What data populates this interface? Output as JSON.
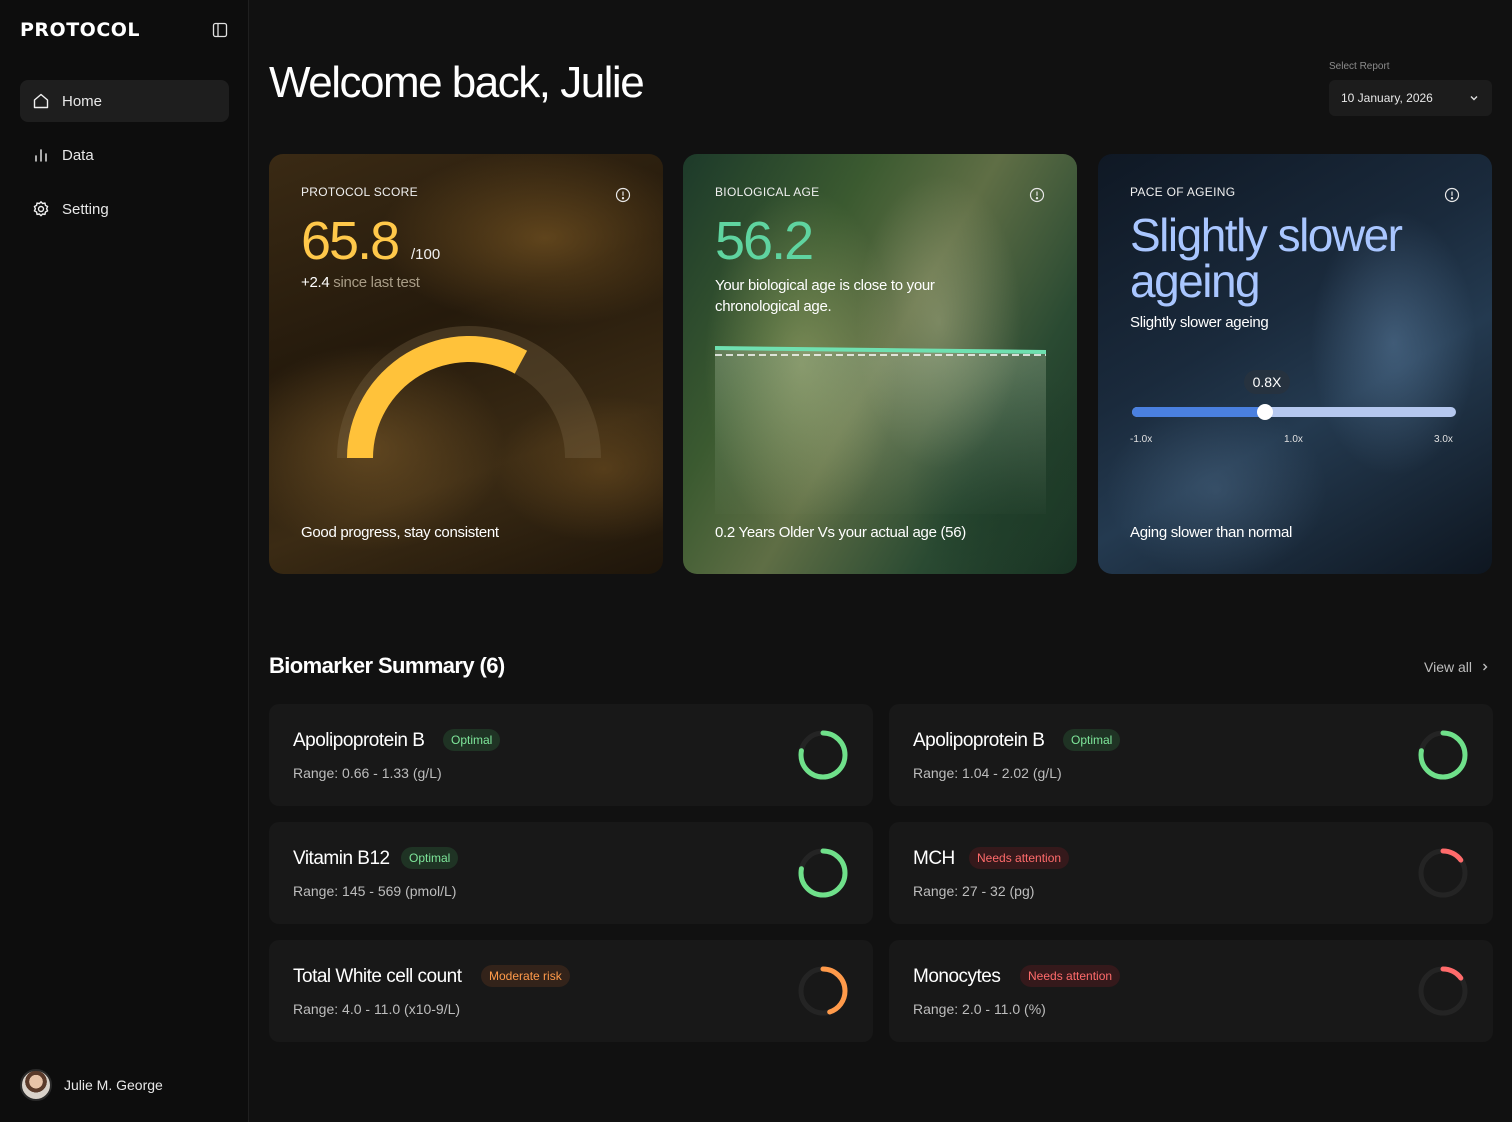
{
  "app": {
    "logo": "PROTOCOL"
  },
  "sidebar": {
    "items": [
      {
        "label": "Home",
        "icon": "home-icon",
        "active": true
      },
      {
        "label": "Data",
        "icon": "bar-chart-icon",
        "active": false
      },
      {
        "label": "Setting",
        "icon": "gear-icon",
        "active": false
      }
    ],
    "user": {
      "name": "Julie M. George"
    }
  },
  "header": {
    "title": "Welcome back, Julie",
    "report_label": "Select Report",
    "report_value": "10 January, 2026"
  },
  "cards": {
    "score": {
      "label": "PROTOCOL SCORE",
      "value": "65.8",
      "max": "/100",
      "delta": "+2.4",
      "delta_suffix": " since last test",
      "footer": "Good progress, stay consistent",
      "gauge_fraction": 0.658,
      "color": "#ffc84a"
    },
    "bio": {
      "label": "BIOLOGICAL AGE",
      "value": "56.2",
      "description": "Your biological age is close to your chronological age.",
      "footer": "0.2 Years Older Vs your actual age (56)",
      "color": "#5fd4a0"
    },
    "pace": {
      "label": "PACE OF AGEING",
      "value": "Slightly slower ageing",
      "subtitle": "Slightly slower ageing",
      "badge": "0.8X",
      "slider_fraction": 0.41,
      "ticks": [
        "-1.0x",
        "1.0x",
        "3.0x"
      ],
      "footer": "Aging slower than normal",
      "color": "#a9c6ff"
    }
  },
  "biomarkers": {
    "title": "Biomarker Summary (6)",
    "view_all": "View all",
    "items": [
      {
        "name": "Apolipoprotein B",
        "status": "Optimal",
        "range": "Range: 0.66 - 1.33 (g/L)",
        "level": 0.78,
        "color": "#6fe08a",
        "badge_bg": "#1f3324",
        "badge_fg": "#7ee69a"
      },
      {
        "name": "Apolipoprotein B",
        "status": "Optimal",
        "range": "Range: 1.04 - 2.02 (g/L)",
        "level": 0.78,
        "color": "#6fe08a",
        "badge_bg": "#1f3324",
        "badge_fg": "#7ee69a"
      },
      {
        "name": "Vitamin B12",
        "status": "Optimal",
        "range": "Range: 145 - 569 (pmol/L)",
        "level": 0.78,
        "color": "#6fe08a",
        "badge_bg": "#1f3324",
        "badge_fg": "#7ee69a"
      },
      {
        "name": "MCH",
        "status": "Needs attention",
        "range": "Range: 27 - 32 (pg)",
        "level": 0.15,
        "color": "#ff6b6b",
        "badge_bg": "#35191b",
        "badge_fg": "#ff6b6b"
      },
      {
        "name": "Total White cell count",
        "status": "Moderate risk",
        "range": "Range: 4.0 - 11.0 (x10-9/L)",
        "level": 0.45,
        "color": "#ff9a4a",
        "badge_bg": "#33231a",
        "badge_fg": "#ff9a4a"
      },
      {
        "name": "Monocytes",
        "status": "Needs attention",
        "range": "Range: 2.0 - 11.0 (%)",
        "level": 0.15,
        "color": "#ff6b6b",
        "badge_bg": "#35191b",
        "badge_fg": "#ff6b6b"
      }
    ]
  }
}
